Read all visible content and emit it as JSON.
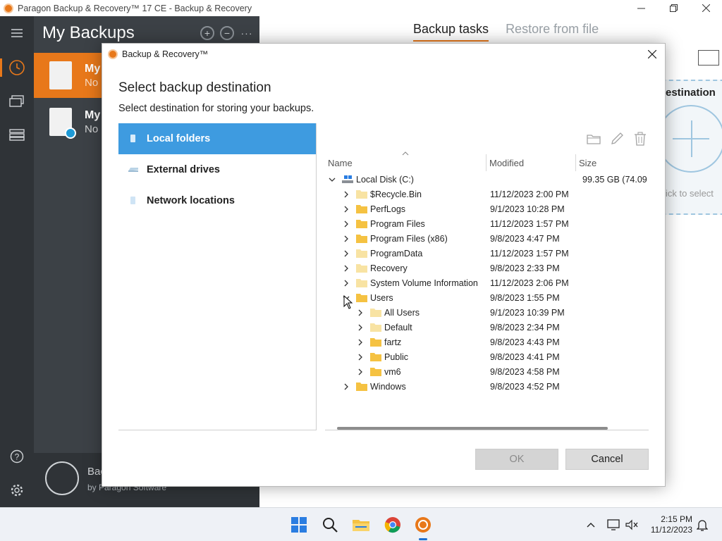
{
  "app": {
    "title": "Paragon Backup & Recovery™ 17 CE - Backup & Recovery",
    "window_controls": [
      "minimize",
      "maximize",
      "close"
    ]
  },
  "sidebar": {
    "title": "My Backups",
    "items": [
      {
        "name": "My",
        "sub": "No",
        "active": true
      },
      {
        "name": "My",
        "sub": "No",
        "active": false
      }
    ],
    "footer": {
      "name": "Bac",
      "by": "by Paragon Software"
    }
  },
  "main": {
    "tabs": [
      {
        "label": "Backup tasks",
        "active": true
      },
      {
        "label": "Restore from file",
        "active": false
      }
    ],
    "destination_card": {
      "label": "estination",
      "hint": "ick to select"
    }
  },
  "dialog": {
    "title": "Backup & Recovery™",
    "heading": "Select backup destination",
    "subheading": "Select destination for storing your backups.",
    "nav": [
      {
        "label": "Local folders",
        "selected": true,
        "icon": "folder-icon"
      },
      {
        "label": "External drives",
        "selected": false,
        "icon": "external-drive-icon"
      },
      {
        "label": "Network locations",
        "selected": false,
        "icon": "network-icon"
      }
    ],
    "columns": [
      "Name",
      "Modified",
      "Size"
    ],
    "tree": [
      {
        "name": "Local Disk (C:)",
        "modified": "",
        "size": "99.35 GB (74.09",
        "expanded": true,
        "type": "disk"
      },
      {
        "name": "$Recycle.Bin",
        "modified": "11/12/2023 2:00 PM",
        "size": "",
        "expanded": false,
        "type": "folder-light"
      },
      {
        "name": "PerfLogs",
        "modified": "9/1/2023 10:28 PM",
        "size": "",
        "expanded": false,
        "type": "folder"
      },
      {
        "name": "Program Files",
        "modified": "11/12/2023 1:57 PM",
        "size": "",
        "expanded": false,
        "type": "folder"
      },
      {
        "name": "Program Files (x86)",
        "modified": "9/8/2023 4:47 PM",
        "size": "",
        "expanded": false,
        "type": "folder"
      },
      {
        "name": "ProgramData",
        "modified": "11/12/2023 1:57 PM",
        "size": "",
        "expanded": false,
        "type": "folder-light"
      },
      {
        "name": "Recovery",
        "modified": "9/8/2023 2:33 PM",
        "size": "",
        "expanded": false,
        "type": "folder-light"
      },
      {
        "name": "System Volume Information",
        "modified": "11/12/2023 2:06 PM",
        "size": "",
        "expanded": false,
        "type": "folder-light"
      },
      {
        "name": "Users",
        "modified": "9/8/2023 1:55 PM",
        "size": "",
        "expanded": true,
        "type": "folder"
      },
      {
        "name": "All Users",
        "modified": "9/1/2023 10:39 PM",
        "size": "",
        "expanded": false,
        "type": "folder-light"
      },
      {
        "name": "Default",
        "modified": "9/8/2023 2:34 PM",
        "size": "",
        "expanded": false,
        "type": "folder-light"
      },
      {
        "name": "fartz",
        "modified": "9/8/2023 4:43 PM",
        "size": "",
        "expanded": false,
        "type": "folder"
      },
      {
        "name": "Public",
        "modified": "9/8/2023 4:41 PM",
        "size": "",
        "expanded": false,
        "type": "folder"
      },
      {
        "name": "vm6",
        "modified": "9/8/2023 4:58 PM",
        "size": "",
        "expanded": false,
        "type": "folder"
      },
      {
        "name": "Windows",
        "modified": "9/8/2023 4:52 PM",
        "size": "",
        "expanded": false,
        "type": "folder"
      }
    ],
    "toolbar_icons": [
      "new-folder-icon",
      "rename-icon",
      "delete-icon"
    ],
    "ok_label": "OK",
    "cancel_label": "Cancel"
  },
  "taskbar": {
    "apps": [
      "start-icon",
      "search-icon",
      "file-explorer-icon",
      "chrome-icon",
      "paragon-icon"
    ],
    "time": "2:15 PM",
    "date": "11/12/2023"
  },
  "colors": {
    "accent_orange": "#e8781a",
    "selection_blue": "#3e9be0",
    "folder_yellow": "#f5c242",
    "folder_light": "#f8e3a3"
  }
}
